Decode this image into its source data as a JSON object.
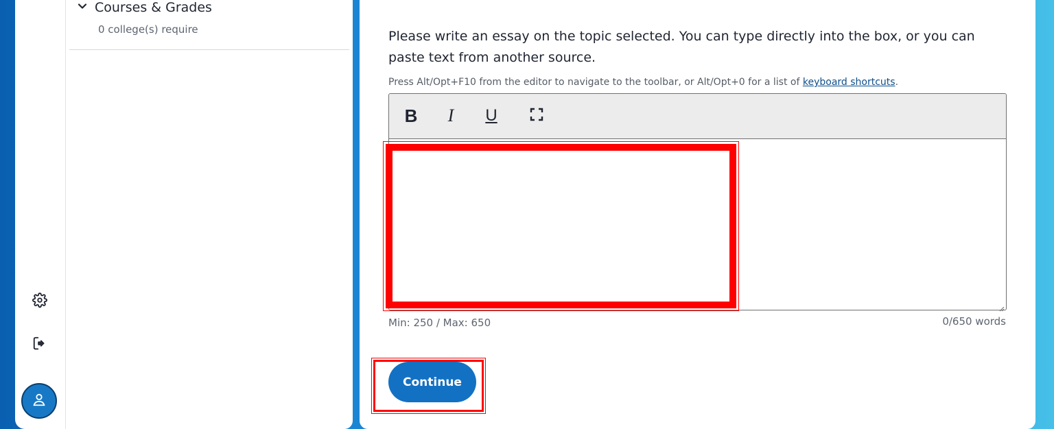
{
  "sidebar": {
    "section_title": "Courses & Grades",
    "section_subtitle": "0 college(s) require",
    "expand_icon": "chevron-down-icon"
  },
  "rail": {
    "icons": [
      "gear-icon",
      "sign-out-icon",
      "user-icon"
    ]
  },
  "essay": {
    "prompt": "Please write an essay on the topic selected. You can type directly into the box, or you can paste text from another source.",
    "hint_text": "Press Alt/Opt+F10 from the editor to navigate to the toolbar, or Alt/Opt+0 for a list of ",
    "hint_link": "keyboard shortcuts",
    "hint_end": ".",
    "toolbar": {
      "bold": "B",
      "italic": "I",
      "underline": "U",
      "fullscreen_icon": "fullscreen-icon"
    },
    "content": "",
    "limits": "Min: 250 / Max: 650",
    "word_count": "0/650 words"
  },
  "actions": {
    "continue_label": "Continue"
  },
  "colors": {
    "accent": "#1371c3",
    "highlight": "#ff0000"
  }
}
